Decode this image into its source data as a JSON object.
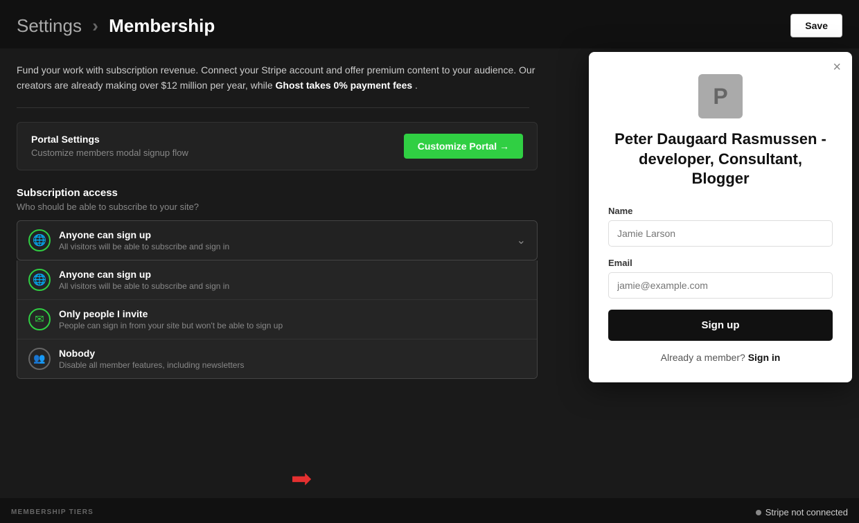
{
  "header": {
    "breadcrumb_start": "Settings",
    "separator": "›",
    "breadcrumb_end": "Membership",
    "save_label": "Save"
  },
  "description": {
    "text_normal": "Fund your work with subscription revenue. Connect your Stripe account and offer premium content to your audience. Our creators are already making over $12 million per year, while ",
    "text_bold": "Ghost takes 0% payment fees",
    "text_end": "."
  },
  "portal": {
    "title": "Portal Settings",
    "subtitle": "Customize members modal signup flow",
    "customize_label": "Customize Portal →"
  },
  "subscription_access": {
    "title": "Subscription access",
    "subtitle": "Who should be able to subscribe to your site?",
    "selected": {
      "icon": "🌐",
      "title": "Anyone can sign up",
      "subtitle": "All visitors will be able to subscribe and sign in"
    },
    "options": [
      {
        "icon": "🌐",
        "title": "Anyone can sign up",
        "subtitle": "All visitors will be able to subscribe and sign in"
      },
      {
        "icon": "✉",
        "title": "Only people I invite",
        "subtitle": "People can sign in from your site but won't be able to sign up"
      },
      {
        "icon": "👥",
        "title": "Nobody",
        "subtitle": "Disable all member features, including newsletters",
        "disabled": true
      }
    ]
  },
  "bottom_bar": {
    "membership_tiers_label": "MEMBERSHIP TIERS",
    "stripe_status": "Stripe not connected"
  },
  "modal": {
    "avatar_letter": "P",
    "title": "Peter Daugaard Rasmussen - developer, Consultant, Blogger",
    "name_label": "Name",
    "name_placeholder": "Jamie Larson",
    "email_label": "Email",
    "email_placeholder": "jamie@example.com",
    "signup_label": "Sign up",
    "signin_text": "Already a member?",
    "signin_link": "Sign in",
    "close_icon": "×"
  }
}
